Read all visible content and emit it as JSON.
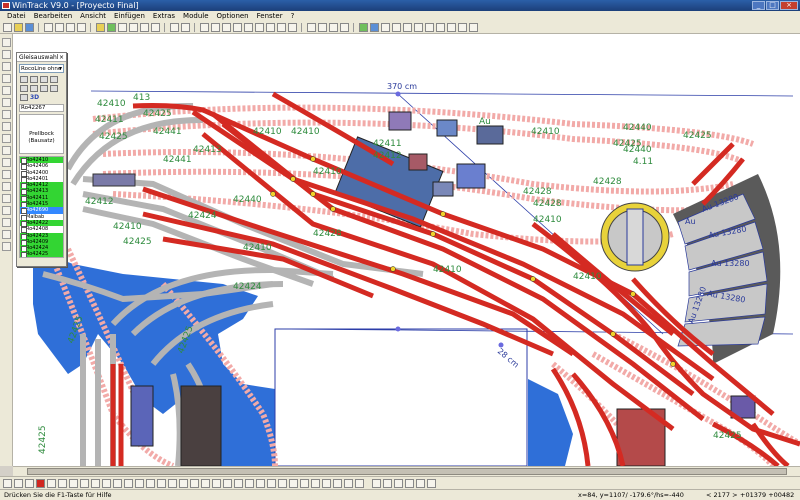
{
  "window": {
    "title": "WinTrack  V9.0 - [Proyecto Final]"
  },
  "menu": {
    "items": [
      "Datei",
      "Bearbeiten",
      "Ansicht",
      "Einfügen",
      "Extras",
      "Module",
      "Optionen",
      "Fenster",
      "?"
    ]
  },
  "palette": {
    "title": "Gleisauswahl",
    "close": "×",
    "set": "RocoLine ohne",
    "three_d": "3D",
    "code": "Ro42267",
    "preview_line1": "Prellbock",
    "preview_line2": "(Bausatz)",
    "items": [
      "Ro42410",
      "Ro42406",
      "Ro42400",
      "Ro42401",
      "Ro42412",
      "Ro42413",
      "Ro42411",
      "Ro42415",
      "Ro42690",
      "Malbab",
      "Ro42422",
      "Ro42408",
      "Ro42423",
      "Ro42409",
      "Ro42424",
      "Ro42425"
    ]
  },
  "canvas": {
    "dimension_top": "370 cm",
    "dimension_diag": "28 cm",
    "turntable_labels": [
      "Au 13280",
      "Au 13280",
      "Au 13280",
      "Au 13280",
      "Au 13280",
      "Au"
    ],
    "track_labels": [
      "42410",
      "42410",
      "42410",
      "42410",
      "42410",
      "42410",
      "42410",
      "42411",
      "42412",
      "42413",
      "42425",
      "42425",
      "42425",
      "42425",
      "42425",
      "42425",
      "42428",
      "42428",
      "42428",
      "42428",
      "42440",
      "42440",
      "42440",
      "42441",
      "42441",
      "42424",
      "42424",
      "42412",
      "42410",
      "42425",
      "42425",
      "42410",
      "42425",
      "42411",
      "42410",
      "4.11",
      "413",
      "Au"
    ]
  },
  "statusbar": {
    "help": "Drücken Sie die  F1-Taste für Hilfe",
    "coords": "x=84, y=1107/ -179.6°/hs=-440",
    "count": "< 2177 >",
    "offset": "+01379  +00482"
  },
  "colors": {
    "track_red": "#d42a22",
    "track_grey": "#b4b4b4",
    "water_blue": "#2f6fd8",
    "label_green": "#2e8b3d",
    "ghost_pink": "#f2aaa8"
  }
}
